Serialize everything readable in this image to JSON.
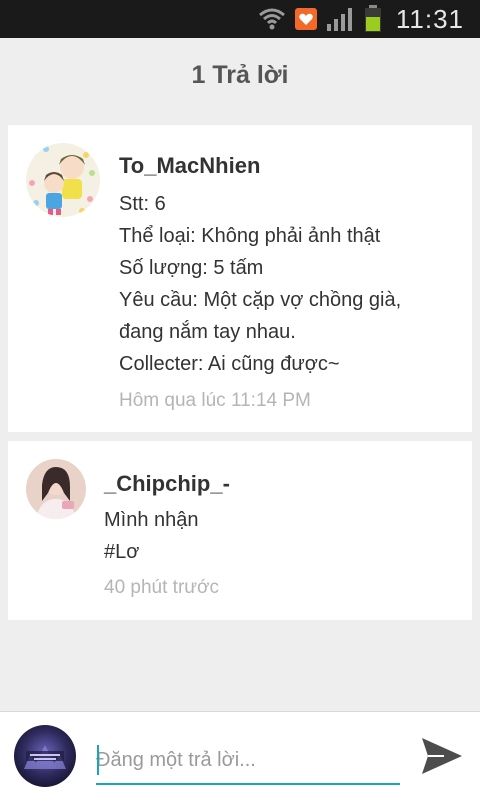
{
  "status_bar": {
    "time": "11:31"
  },
  "header": {
    "title": "1 Trả lời"
  },
  "posts": [
    {
      "username": "To_MacNhien",
      "lines": [
        "Stt: 6",
        "Thể loại: Không phải ảnh thật",
        "Số lượng: 5 tấm",
        "Yêu cầu: Một cặp vợ chồng già,",
        "đang nắm tay nhau.",
        "Collecter: Ai cũng được~"
      ],
      "timestamp": "Hôm qua lúc 11:14 PM"
    },
    {
      "username": "_Chipchip_-",
      "lines": [
        "Mình nhận",
        "#Lơ"
      ],
      "timestamp": "40 phút trước"
    }
  ],
  "reply": {
    "placeholder": "Đăng một trả lời..."
  },
  "colors": {
    "accent": "#1aa6b7",
    "status_bar": "#1a1a1a",
    "background": "#eeeeee"
  }
}
